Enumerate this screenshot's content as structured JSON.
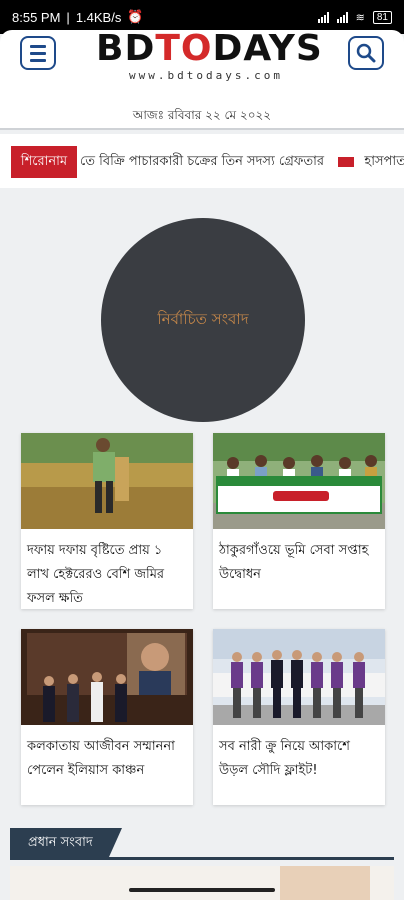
{
  "status_bar": {
    "time": "8:55 PM",
    "speed": "1.4KB/s",
    "battery": "81"
  },
  "header": {
    "logo_prefix": "BD",
    "logo_o": "O",
    "logo_t": "T",
    "logo_suffix": "DAYS",
    "logo_url": "www.bdtodays.com",
    "menu_icon": "hamburger-icon",
    "search_icon": "search-icon"
  },
  "date_text": "আজঃ রবিবার ২২ মে ২০২২",
  "ticker": {
    "badge": "শিরোনাম",
    "headline_1": "তে বিক্রি পাচারকারী চক্রের তিন সদস্য গ্রেফতার",
    "headline_2": "হাসপাত"
  },
  "featured": {
    "label": "নির্বাচিত সংবাদ"
  },
  "cards": [
    {
      "title": "দফায় দফায় বৃষ্টিতে প্রায় ১ লাখ হেক্টরেরও বেশি জমির ফসল ক্ষতি"
    },
    {
      "title": "ঠাকুরগাঁওয়ে ভূমি সেবা সপ্তাহ উদ্বোধন"
    },
    {
      "title": "কলকাতায় আজীবন সম্মাননা পেলেন ইলিয়াস কাঞ্চন"
    },
    {
      "title": "সব নারী ক্রু নিয়ে আকাশে উড়ল সৌদি ফ্লাইট!"
    }
  ],
  "section": {
    "title": "প্রধান সংবাদ"
  },
  "colors": {
    "brand_blue": "#1e4a8a",
    "accent_red": "#c8202a",
    "featured_bg": "#3a3d42",
    "section_bg": "#2c3e50"
  }
}
